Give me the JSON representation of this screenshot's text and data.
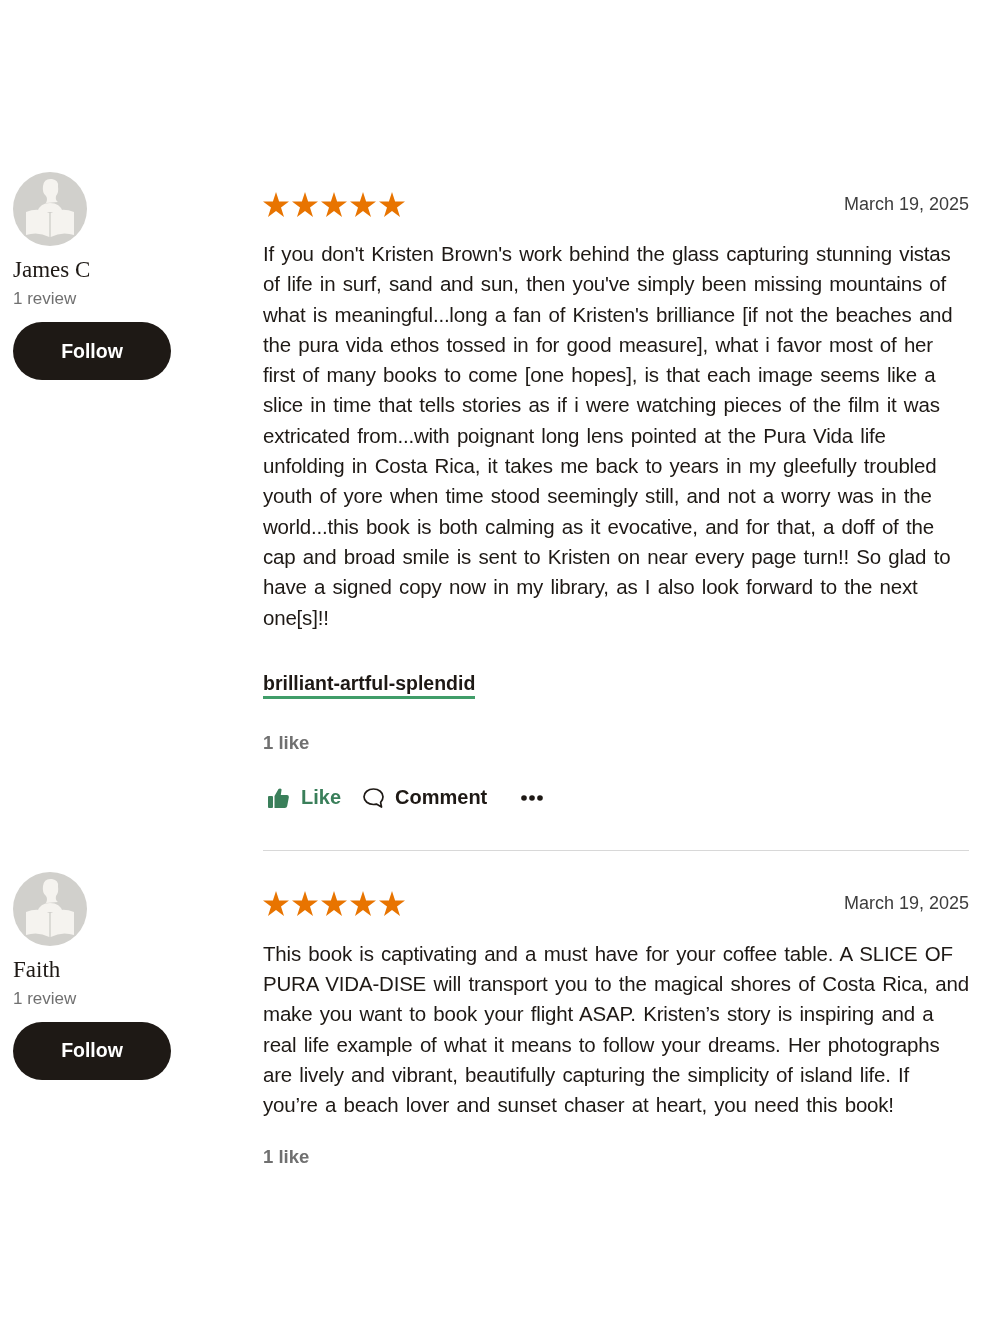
{
  "reviews": [
    {
      "reviewer": {
        "name": "James C",
        "review_count": "1 review",
        "follow_label": "Follow"
      },
      "stars": 5,
      "date": "March 19, 2025",
      "text": "If you don't Kristen Brown's work behind the glass capturing stunning vistas of life in surf, sand and sun, then you've simply been missing mountains of what is meaningful...long a fan of Kristen's brilliance [if not the beaches and the pura vida ethos tossed in for good measure], what i favor most of her first of many books to come [one hopes], is that each image seems like a slice in time that tells stories as if i were watching pieces of the film it was extricated from...with poignant long lens pointed at the Pura Vida life unfolding in Costa Rica, it takes me back to years in my gleefully troubled youth of yore when time stood seemingly still, and not a worry was in the world...this book is both calming as it evocative, and for that, a doff of the cap and broad smile is sent to Kristen on near every page turn!! So glad to have a signed copy now in my library, as I also look forward to the next one[s]!!",
      "shelves": [
        "brilliant-artful-splendid"
      ],
      "likes": "1 like",
      "actions": [
        {
          "kind": "like",
          "label": "Like"
        },
        {
          "kind": "comment",
          "label": "Comment"
        },
        {
          "kind": "more"
        }
      ]
    },
    {
      "reviewer": {
        "name": "Faith",
        "review_count": "1 review",
        "follow_label": "Follow"
      },
      "stars": 5,
      "date": "March 19, 2025",
      "text": "This book is captivating and a must have for your coffee table. A SLICE OF PURA VIDA-DISE will transport you to the magical shores of Costa Rica, and make you want to book your flight ASAP. Kristen’s story is inspiring and a real life example of what it means to follow your dreams. Her photographs are lively and vibrant, beautifully capturing the simplicity of island life. If you’re a beach lover and sunset chaser at heart, you need this book!",
      "likes": "1 like"
    }
  ]
}
